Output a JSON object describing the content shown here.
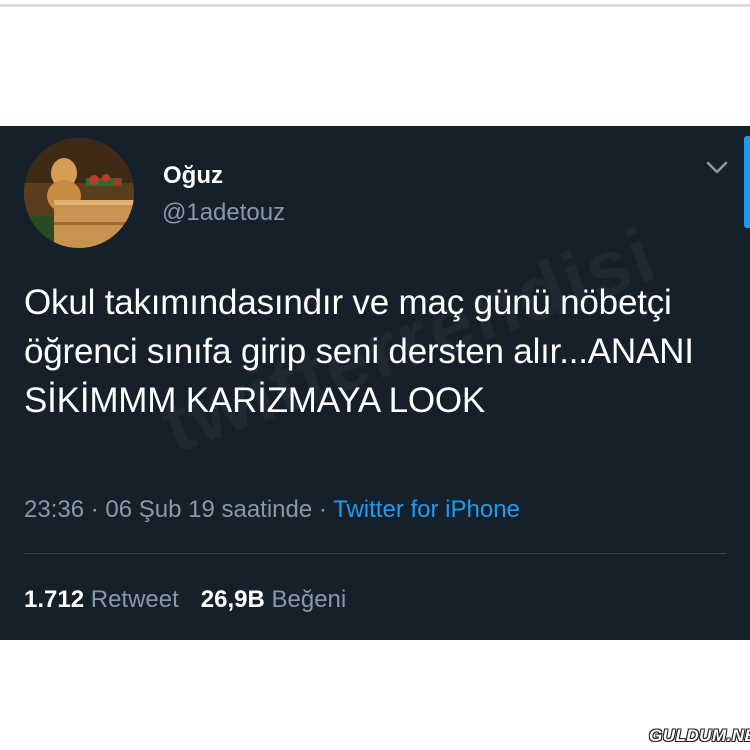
{
  "tweet": {
    "display_name": "Oğuz",
    "handle": "@1adetouz",
    "text": "Okul takımındasındır ve maç günü nöbetçi öğrenci sınıfa girip seni dersten alır...ANANI SİKİMMM KARİZMAYA LOOK",
    "time": "23:36",
    "date_label": "06 Şub 19 saatinde",
    "separator": " · ",
    "source": "Twitter for iPhone",
    "retweet_count": "1.712",
    "retweet_label": "Retweet",
    "like_count": "26,9B",
    "like_label": "Beğeni"
  },
  "icons": {
    "avatar": "avatar-dog-photo",
    "menu": "chevron-down-icon"
  },
  "colors": {
    "card_background": "#15202b",
    "secondary_text": "#8899a6",
    "link": "#1d9bf0",
    "divider": "#38444d"
  },
  "watermark_text": "twitterrendisi",
  "site_logo": "GULDUM.NET"
}
